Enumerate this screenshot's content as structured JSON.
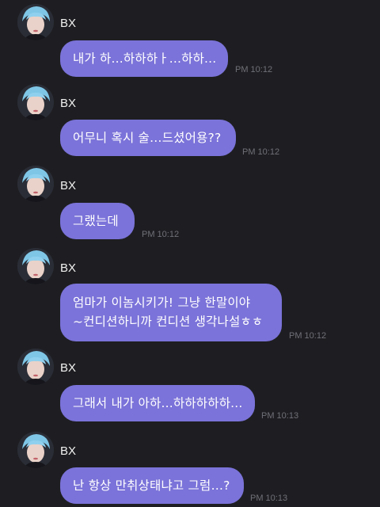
{
  "colors": {
    "background": "#1e1e22",
    "bubble": "#7b73d9",
    "bubble_text": "#ffffff",
    "timestamp": "#6f6f78",
    "name": "#f0f0f0"
  },
  "messages": [
    {
      "sender": "BX",
      "avatar_icon": "profile-avatar-icon",
      "text": "내가 하...하하하ㅏ...하하...",
      "time": "PM 10:12"
    },
    {
      "sender": "BX",
      "avatar_icon": "profile-avatar-icon",
      "text": "어무니 혹시 술…드셨어용??",
      "time": "PM 10:12"
    },
    {
      "sender": "BX",
      "avatar_icon": "profile-avatar-icon",
      "text": "그랬는데",
      "time": "PM 10:12"
    },
    {
      "sender": "BX",
      "avatar_icon": "profile-avatar-icon",
      "text_line1": "엄마가 이놈시키가! 그냥 한말이야",
      "text_line2": "~컨디션하니까 컨디션 생각나설ㅎㅎ",
      "time": "PM 10:12"
    },
    {
      "sender": "BX",
      "avatar_icon": "profile-avatar-icon",
      "text": "그래서 내가 아하...하하하하하...",
      "time": "PM 10:13"
    },
    {
      "sender": "BX",
      "avatar_icon": "profile-avatar-icon",
      "text": "난 항상 만취상태냐고 그럼…?",
      "time": "PM 10:13"
    }
  ]
}
